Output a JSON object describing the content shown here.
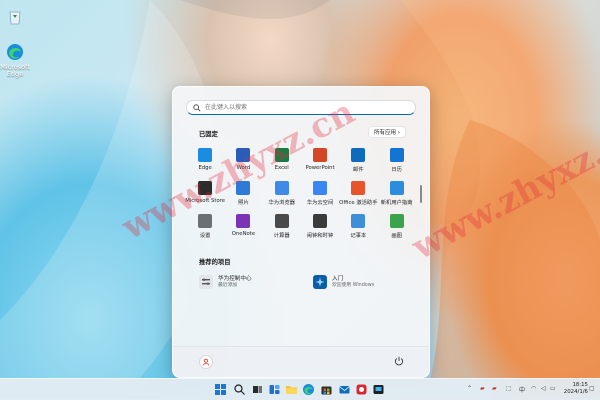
{
  "desktop": {
    "icons": [
      {
        "label": ""
      },
      {
        "label": "Microsoft Edge"
      }
    ]
  },
  "start_menu": {
    "search": {
      "placeholder": "在此键入以搜索"
    },
    "pinned": {
      "title": "已固定",
      "all_apps_label": "所有应用 ›",
      "apps": [
        {
          "label": "Edge",
          "icon": "edge-icon",
          "color": "#1b8de0"
        },
        {
          "label": "Word",
          "icon": "word-icon",
          "color": "#2b5db8"
        },
        {
          "label": "Excel",
          "icon": "excel-icon",
          "color": "#1e7a45"
        },
        {
          "label": "PowerPoint",
          "icon": "powerpoint-icon",
          "color": "#d24726"
        },
        {
          "label": "邮件",
          "icon": "mail-icon",
          "color": "#0f6cbd"
        },
        {
          "label": "日历",
          "icon": "calendar-icon",
          "color": "#1374d2"
        },
        {
          "label": "Microsoft Store",
          "icon": "store-icon",
          "color": "#2c2c2c"
        },
        {
          "label": "照片",
          "icon": "photos-icon",
          "color": "#2f7ad6"
        },
        {
          "label": "华为浏览器",
          "icon": "huawei-browser-icon",
          "color": "#3f8ae8"
        },
        {
          "label": "华为云空间",
          "icon": "huawei-cloud-icon",
          "color": "#3a86f0"
        },
        {
          "label": "Office 激活助手",
          "icon": "office-icon",
          "color": "#e8542c"
        },
        {
          "label": "新机用户指南",
          "icon": "guide-icon",
          "color": "#2d8cdc"
        },
        {
          "label": "设置",
          "icon": "settings-icon",
          "color": "#6b6f76"
        },
        {
          "label": "OneNote",
          "icon": "onenote-icon",
          "color": "#7b34b6"
        },
        {
          "label": "计算器",
          "icon": "calculator-icon",
          "color": "#4a4a4a"
        },
        {
          "label": "闹钟和时钟",
          "icon": "clock-icon",
          "color": "#3b3b3b"
        },
        {
          "label": "记事本",
          "icon": "notepad-icon",
          "color": "#3f8fd8"
        },
        {
          "label": "画图",
          "icon": "paint-icon",
          "color": "#3aa44c"
        }
      ]
    },
    "recommended": {
      "title": "推荐的项目",
      "items": [
        {
          "title": "华为控制中心",
          "subtitle": "最近添加",
          "icon": "control-center-icon"
        },
        {
          "title": "入门",
          "subtitle": "欢迎使用 Windows",
          "icon": "get-started-icon"
        }
      ]
    }
  },
  "taskbar": {
    "apps": [
      "windows-start-icon",
      "search-icon",
      "task-view-icon",
      "widgets-icon",
      "file-explorer-icon",
      "edge-icon",
      "store-icon",
      "mail-icon",
      "huawei-app-icon"
    ],
    "clock": {
      "time": "18:15",
      "date": "2024/1/6"
    }
  },
  "watermark": {
    "text": "www.zhyxz.cn"
  }
}
